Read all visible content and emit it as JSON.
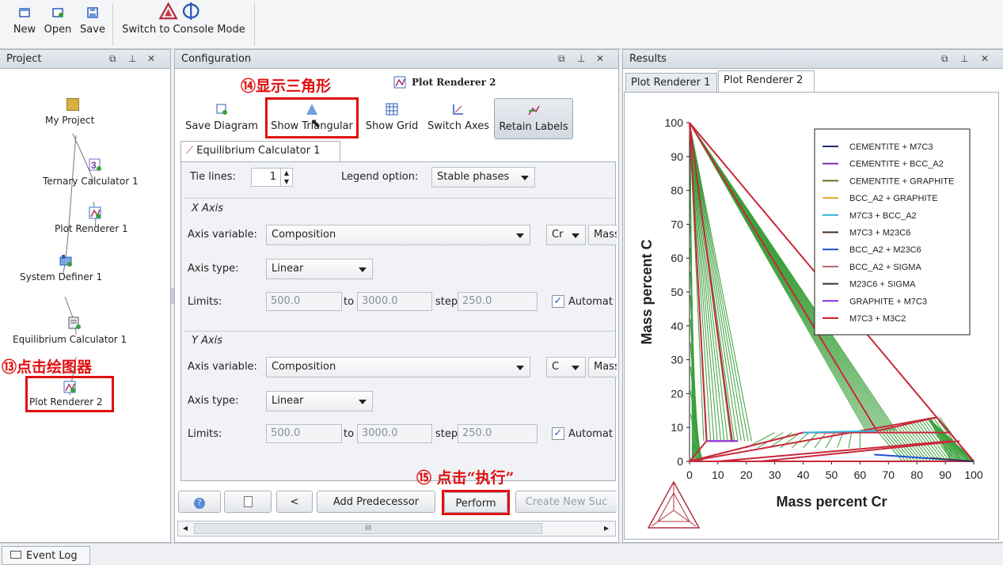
{
  "toolbar": {
    "new_label": "New",
    "open_label": "Open",
    "save_label": "Save",
    "console_label": "Switch to Console Mode"
  },
  "project": {
    "title": "Project",
    "nodes": [
      {
        "label": "My Project"
      },
      {
        "label": "Ternary Calculator 1"
      },
      {
        "label": "Plot Renderer 1"
      },
      {
        "label": "System Definer 1"
      },
      {
        "label": "Equilibrium Calculator 1"
      },
      {
        "label": "Plot Renderer 2"
      }
    ]
  },
  "annotations": {
    "step13": "⑬点击绘图器",
    "step14": "⑭显示三角形",
    "step15": "⑮ 点击“执行”"
  },
  "configuration": {
    "title": "Configuration",
    "renderer_title": "Plot Renderer 2",
    "buttons": {
      "save_diagram": "Save Diagram",
      "show_triangular": "Show Triangular",
      "show_grid": "Show Grid",
      "switch_axes": "Switch Axes",
      "retain_labels": "Retain Labels"
    },
    "tab_label": "Equilibrium Calculator 1",
    "tie_lines_label": "Tie lines:",
    "tie_lines_value": "1",
    "legend_option_label": "Legend option:",
    "legend_option_value": "Stable phases",
    "x_axis": {
      "title": "X Axis",
      "axis_variable_label": "Axis variable:",
      "axis_variable_value": "Composition",
      "element_value": "Cr",
      "unit_value": "Mass",
      "axis_type_label": "Axis type:",
      "axis_type_value": "Linear",
      "limits_label": "Limits:",
      "limit_from": "500.0",
      "to_label": "to",
      "limit_to": "3000.0",
      "step_label": "step",
      "step_value": "250.0",
      "automatic_label": "Automat"
    },
    "y_axis": {
      "title": "Y Axis",
      "axis_variable_label": "Axis variable:",
      "axis_variable_value": "Composition",
      "element_value": "C",
      "unit_value": "Mass",
      "axis_type_label": "Axis type:",
      "axis_type_value": "Linear",
      "limits_label": "Limits:",
      "limit_from": "500.0",
      "to_label": "to",
      "limit_to": "3000.0",
      "step_label": "step",
      "step_value": "250.0",
      "automatic_label": "Automat"
    },
    "bottom_buttons": {
      "back": "<",
      "add_predecessor": "Add Predecessor",
      "perform": "Perform",
      "create_new": "Create New Suc"
    },
    "scroll_glyph": "III"
  },
  "results": {
    "title": "Results",
    "tabs": [
      "Plot Renderer 1",
      "Plot Renderer 2"
    ],
    "active_tab": 1
  },
  "chart_data": {
    "type": "line",
    "xlabel": "Mass percent Cr",
    "ylabel": "Mass percent C",
    "xlim": [
      0,
      100
    ],
    "ylim": [
      0,
      100
    ],
    "x_ticks": [
      0,
      10,
      20,
      30,
      40,
      50,
      60,
      70,
      80,
      90,
      100
    ],
    "y_ticks": [
      0,
      10,
      20,
      30,
      40,
      50,
      60,
      70,
      80,
      90,
      100
    ],
    "legend_placement": "top-right",
    "legend": [
      {
        "name": "CEMENTITE + M7C3",
        "color": "#1f2f6e"
      },
      {
        "name": "CEMENTITE + BCC_A2",
        "color": "#7a2fb0"
      },
      {
        "name": "CEMENTITE + GRAPHITE",
        "color": "#6b6b1a"
      },
      {
        "name": "BCC_A2 + GRAPHITE",
        "color": "#f0a030"
      },
      {
        "name": "M7C3 + BCC_A2",
        "color": "#2fb6e0"
      },
      {
        "name": "M7C3 + M23C6",
        "color": "#4a2a1a"
      },
      {
        "name": "BCC_A2 + M23C6",
        "color": "#2050d0"
      },
      {
        "name": "BCC_A2 + SIGMA",
        "color": "#b06a6a"
      },
      {
        "name": "M23C6 + SIGMA",
        "color": "#333333"
      },
      {
        "name": "GRAPHITE + M7C3",
        "color": "#8a2be2"
      },
      {
        "name": "M7C3 + M3C2",
        "color": "#d02030"
      }
    ],
    "series": [
      {
        "name": "M7C3 + M3C2",
        "points": [
          [
            0,
            100
          ],
          [
            87,
            13
          ],
          [
            92,
            6
          ],
          [
            100,
            0
          ]
        ]
      },
      {
        "name": "GRAPHITE + M7C3",
        "points": [
          [
            0,
            100
          ],
          [
            66,
            9
          ]
        ]
      }
    ]
  },
  "event_log": {
    "label": "Event Log"
  }
}
